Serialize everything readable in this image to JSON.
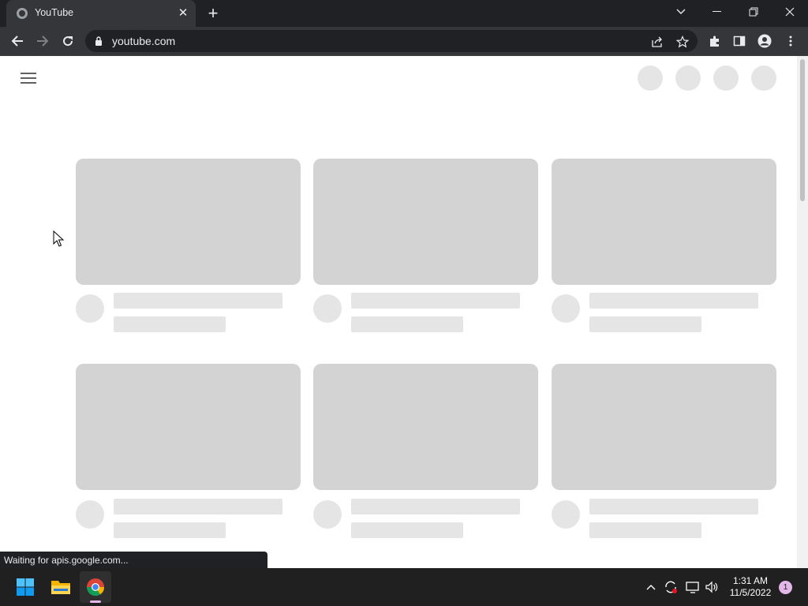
{
  "browser": {
    "tab": {
      "title": "YouTube",
      "close": "✕"
    },
    "new_tab": "+",
    "address": {
      "url": "youtube.com"
    }
  },
  "status_bar": {
    "text": "Waiting for apis.google.com..."
  },
  "taskbar": {
    "clock": {
      "time": "1:31 AM",
      "date": "11/5/2022"
    },
    "notification_count": "1"
  },
  "colors": {
    "chrome_dark": "#202124",
    "chrome_tab": "#35363a",
    "skeleton_thumb": "#d3d3d3",
    "skeleton_light": "#e5e5e5",
    "taskbar": "#202020"
  }
}
